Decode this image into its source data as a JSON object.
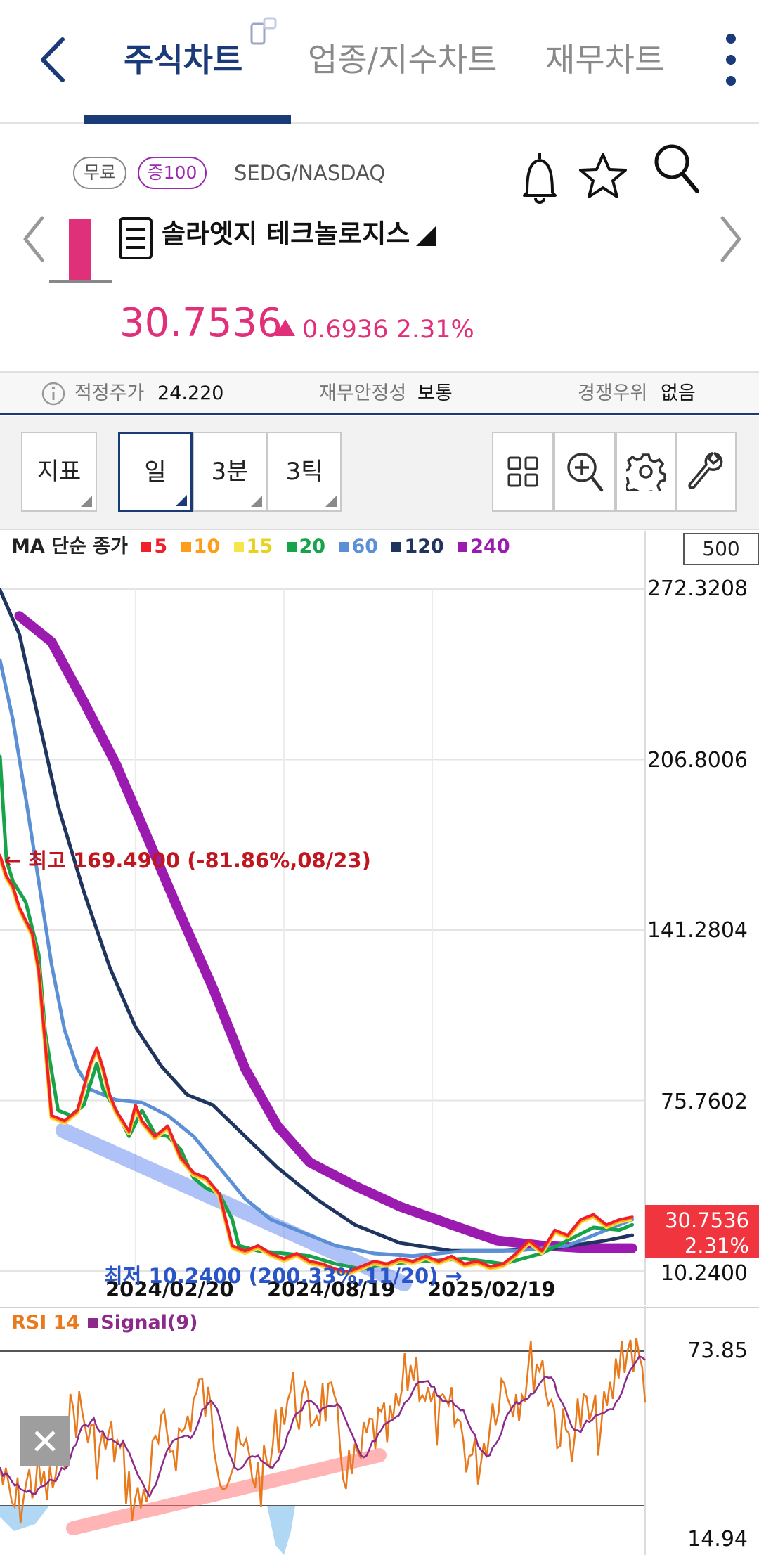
{
  "tabs": [
    {
      "label": "주식차트",
      "active": true
    },
    {
      "label": "업종/지수차트",
      "active": false
    },
    {
      "label": "재무차트",
      "active": false
    }
  ],
  "stock": {
    "badge_free": "무료",
    "badge_margin": "증100",
    "ticker": "SEDG/NASDAQ",
    "name": "솔라엣지 테크놀로지스",
    "price": "30.7536",
    "change": "0.6936",
    "change_pct": "2.31%",
    "up_color": "#e0307a"
  },
  "metrics": {
    "fair_price_label": "적정주가",
    "fair_price_value": "24.220",
    "stability_label": "재무안정성",
    "stability_value": "보통",
    "competitive_label": "경쟁우위",
    "competitive_value": "없음"
  },
  "toolbar": {
    "indicator": "지표",
    "period_day": "일",
    "period_3min": "3분",
    "period_3tick": "3틱"
  },
  "chart_data": {
    "type": "line",
    "title": "",
    "ma_legend": {
      "label": "MA 단순 종가",
      "series": [
        {
          "name": "5",
          "color": "#f0202a"
        },
        {
          "name": "10",
          "color": "#ff9c1a"
        },
        {
          "name": "15",
          "color": "#f5e44a"
        },
        {
          "name": "20",
          "color": "#16a34a"
        },
        {
          "name": "60",
          "color": "#5b8fd6"
        },
        {
          "name": "120",
          "color": "#1f3560"
        },
        {
          "name": "240",
          "color": "#9b1bb1"
        }
      ]
    },
    "visible_count": "500",
    "y_ticks": [
      "272.3208",
      "206.8006",
      "141.2804",
      "75.7602",
      "10.2400"
    ],
    "ylim": [
      10.24,
      272.3208
    ],
    "x_ticks": [
      "2024/02/20",
      "2024/08/19",
      "2025/02/19"
    ],
    "last_price": "30.7536",
    "last_change_pct": "2.31%",
    "high_note": "← 최고 169.4900 (-81.86%,08/23)",
    "low_note": "최저 10.2400 (200.33%,11/20) →",
    "series": [
      {
        "name": "240",
        "color": "#9b1bb1",
        "width": 14,
        "points": [
          [
            0.03,
            262
          ],
          [
            0.08,
            252
          ],
          [
            0.13,
            229
          ],
          [
            0.18,
            205
          ],
          [
            0.23,
            176
          ],
          [
            0.28,
            147
          ],
          [
            0.33,
            119
          ],
          [
            0.38,
            88
          ],
          [
            0.43,
            66
          ],
          [
            0.48,
            52
          ],
          [
            0.55,
            43
          ],
          [
            0.62,
            35
          ],
          [
            0.7,
            28
          ],
          [
            0.77,
            22
          ],
          [
            0.84,
            20
          ],
          [
            0.91,
            19
          ],
          [
            0.98,
            19
          ]
        ]
      },
      {
        "name": "120",
        "color": "#1f3560",
        "width": 5,
        "points": [
          [
            0.0,
            272
          ],
          [
            0.03,
            255
          ],
          [
            0.06,
            222
          ],
          [
            0.09,
            189
          ],
          [
            0.13,
            156
          ],
          [
            0.17,
            127
          ],
          [
            0.21,
            104
          ],
          [
            0.25,
            89
          ],
          [
            0.29,
            78
          ],
          [
            0.33,
            74
          ],
          [
            0.38,
            62
          ],
          [
            0.43,
            50
          ],
          [
            0.49,
            38
          ],
          [
            0.55,
            28
          ],
          [
            0.62,
            21
          ],
          [
            0.7,
            18
          ],
          [
            0.78,
            18
          ],
          [
            0.86,
            19
          ],
          [
            0.94,
            22
          ],
          [
            0.98,
            24
          ]
        ]
      },
      {
        "name": "60",
        "color": "#5b8fd6",
        "width": 5,
        "points": [
          [
            0.0,
            245
          ],
          [
            0.02,
            222
          ],
          [
            0.04,
            192
          ],
          [
            0.06,
            160
          ],
          [
            0.08,
            128
          ],
          [
            0.1,
            103
          ],
          [
            0.12,
            88
          ],
          [
            0.14,
            80
          ],
          [
            0.18,
            76
          ],
          [
            0.22,
            75
          ],
          [
            0.26,
            70
          ],
          [
            0.3,
            62
          ],
          [
            0.34,
            50
          ],
          [
            0.38,
            38
          ],
          [
            0.42,
            30
          ],
          [
            0.47,
            25
          ],
          [
            0.52,
            20
          ],
          [
            0.58,
            17
          ],
          [
            0.64,
            16
          ],
          [
            0.72,
            18
          ],
          [
            0.8,
            18
          ],
          [
            0.88,
            20
          ],
          [
            0.94,
            26
          ],
          [
            0.98,
            30
          ]
        ]
      },
      {
        "name": "20",
        "color": "#16a34a",
        "width": 5,
        "points": [
          [
            0.0,
            208
          ],
          [
            0.01,
            168
          ],
          [
            0.02,
            160
          ],
          [
            0.04,
            152
          ],
          [
            0.06,
            132
          ],
          [
            0.07,
            102
          ],
          [
            0.09,
            72
          ],
          [
            0.11,
            70
          ],
          [
            0.13,
            74
          ],
          [
            0.15,
            90
          ],
          [
            0.16,
            80
          ],
          [
            0.18,
            72
          ],
          [
            0.2,
            62
          ],
          [
            0.22,
            72
          ],
          [
            0.24,
            63
          ],
          [
            0.26,
            62
          ],
          [
            0.28,
            57
          ],
          [
            0.3,
            46
          ],
          [
            0.32,
            42
          ],
          [
            0.34,
            40
          ],
          [
            0.36,
            30
          ],
          [
            0.37,
            20
          ],
          [
            0.4,
            18
          ],
          [
            0.44,
            17
          ],
          [
            0.48,
            16
          ],
          [
            0.52,
            13
          ],
          [
            0.56,
            11
          ],
          [
            0.6,
            13
          ],
          [
            0.66,
            14
          ],
          [
            0.72,
            15
          ],
          [
            0.78,
            13
          ],
          [
            0.84,
            17
          ],
          [
            0.88,
            22
          ],
          [
            0.92,
            27
          ],
          [
            0.96,
            26
          ],
          [
            0.98,
            28
          ]
        ]
      },
      {
        "name": "5",
        "color": "#f0202a",
        "width": 4,
        "points": [
          [
            0.0,
            170
          ],
          [
            0.01,
            162
          ],
          [
            0.02,
            158
          ],
          [
            0.03,
            150
          ],
          [
            0.05,
            140
          ],
          [
            0.06,
            126
          ],
          [
            0.07,
            98
          ],
          [
            0.08,
            70
          ],
          [
            0.1,
            68
          ],
          [
            0.12,
            72
          ],
          [
            0.14,
            90
          ],
          [
            0.15,
            96
          ],
          [
            0.16,
            88
          ],
          [
            0.17,
            78
          ],
          [
            0.18,
            72
          ],
          [
            0.19,
            68
          ],
          [
            0.2,
            64
          ],
          [
            0.21,
            74
          ],
          [
            0.22,
            68
          ],
          [
            0.24,
            62
          ],
          [
            0.26,
            66
          ],
          [
            0.27,
            60
          ],
          [
            0.28,
            54
          ],
          [
            0.3,
            48
          ],
          [
            0.32,
            46
          ],
          [
            0.34,
            40
          ],
          [
            0.35,
            30
          ],
          [
            0.36,
            20
          ],
          [
            0.38,
            18
          ],
          [
            0.4,
            20
          ],
          [
            0.42,
            17
          ],
          [
            0.44,
            15
          ],
          [
            0.46,
            17
          ],
          [
            0.48,
            14
          ],
          [
            0.5,
            13
          ],
          [
            0.52,
            11
          ],
          [
            0.54,
            10
          ],
          [
            0.56,
            12
          ],
          [
            0.58,
            14
          ],
          [
            0.6,
            13
          ],
          [
            0.62,
            15
          ],
          [
            0.64,
            14
          ],
          [
            0.66,
            16
          ],
          [
            0.68,
            14
          ],
          [
            0.7,
            16
          ],
          [
            0.72,
            13
          ],
          [
            0.74,
            14
          ],
          [
            0.76,
            12
          ],
          [
            0.78,
            13
          ],
          [
            0.8,
            17
          ],
          [
            0.82,
            22
          ],
          [
            0.84,
            18
          ],
          [
            0.86,
            26
          ],
          [
            0.88,
            24
          ],
          [
            0.9,
            30
          ],
          [
            0.92,
            32
          ],
          [
            0.94,
            28
          ],
          [
            0.96,
            30
          ],
          [
            0.98,
            31
          ]
        ]
      }
    ]
  },
  "rsi": {
    "label": "RSI 14",
    "signal_label": "Signal(9)",
    "y_ticks": [
      "73.85",
      "14.94"
    ],
    "rsi_color": "#e8791c",
    "signal_color": "#8b2a8b"
  }
}
